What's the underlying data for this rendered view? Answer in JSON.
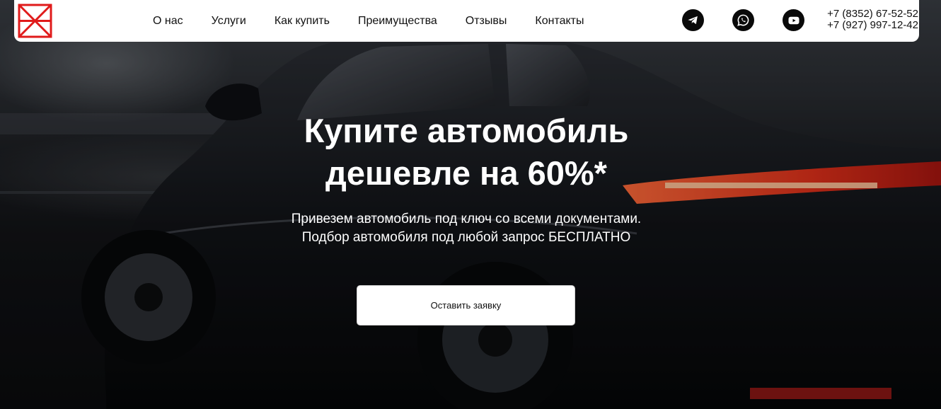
{
  "header": {
    "nav": [
      {
        "label": "О нас"
      },
      {
        "label": "Услуги"
      },
      {
        "label": "Как купить"
      },
      {
        "label": "Преимущества"
      },
      {
        "label": "Отзывы"
      },
      {
        "label": "Контакты"
      }
    ],
    "social": [
      {
        "icon": "telegram-icon"
      },
      {
        "icon": "whatsapp-icon"
      },
      {
        "icon": "youtube-icon"
      }
    ],
    "phones": [
      "+7 (8352) 67-52-52",
      "+7 (927) 997-12-42"
    ]
  },
  "hero": {
    "headline_line1": "Купите автомобиль",
    "headline_line2": "дешевле на 60%*",
    "subtext_line1": "Привезем автомобиль под ключ со всеми документами.",
    "subtext_line2": "Подбор автомобиля под любой запрос БЕСПЛАТНО",
    "cta_label": "Оставить заявку"
  },
  "colors": {
    "logo_red": "#e01b1b",
    "header_bg": "#ffffff",
    "taillight": "#e23a1e"
  }
}
